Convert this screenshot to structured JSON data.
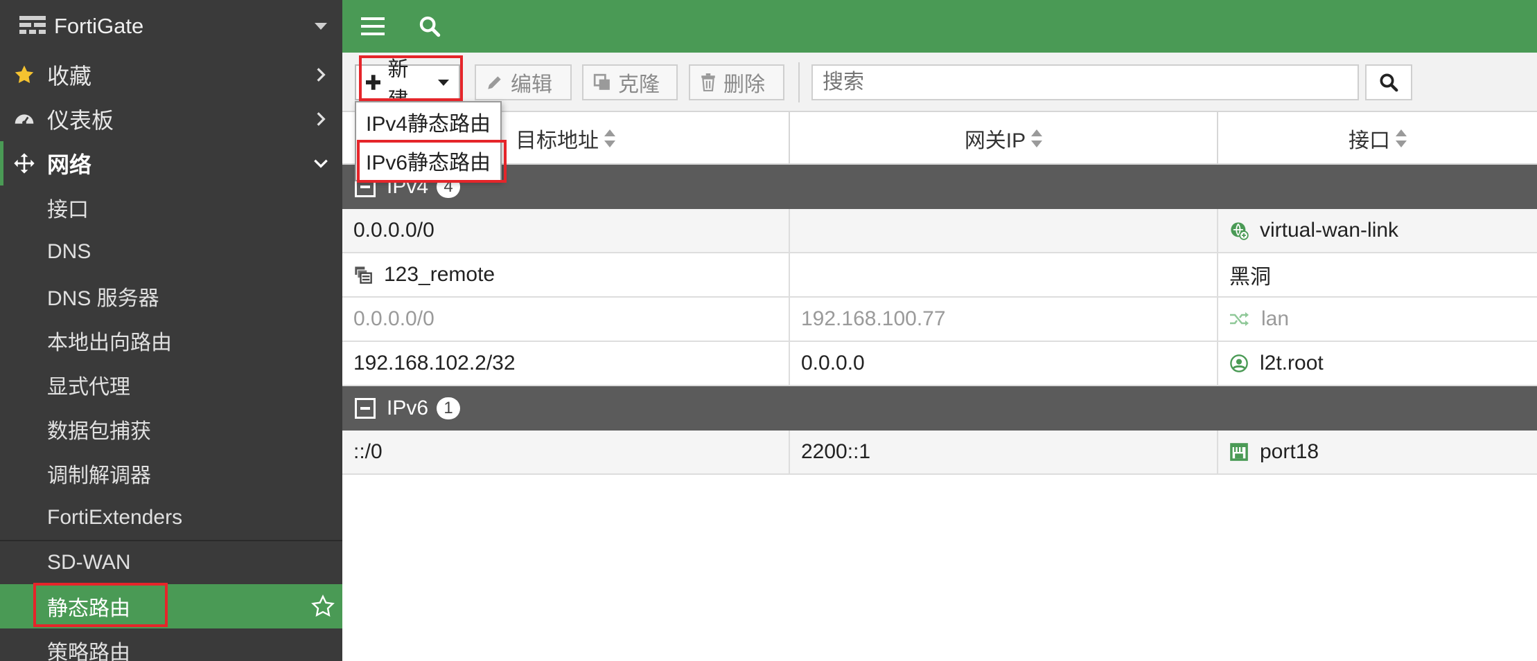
{
  "app": {
    "title": "FortiGate"
  },
  "sidebar": {
    "top_items": [
      {
        "label": "收藏",
        "icon": "star-icon"
      },
      {
        "label": "仪表板",
        "icon": "dashboard-icon"
      },
      {
        "label": "网络",
        "icon": "move-icon"
      }
    ],
    "sub_items": [
      {
        "label": "接口"
      },
      {
        "label": "DNS"
      },
      {
        "label": "DNS 服务器"
      },
      {
        "label": "本地出向路由"
      },
      {
        "label": "显式代理"
      },
      {
        "label": "数据包捕获"
      },
      {
        "label": "调制解调器"
      },
      {
        "label": "FortiExtenders"
      },
      {
        "label": "SD-WAN"
      },
      {
        "label": "静态路由",
        "selected": true
      },
      {
        "label": "策略路由"
      }
    ]
  },
  "toolbar": {
    "new_label": "新建",
    "edit_label": "编辑",
    "clone_label": "克隆",
    "delete_label": "删除",
    "search_placeholder": "搜索"
  },
  "dropdown": {
    "items": [
      {
        "label": "IPv4静态路由"
      },
      {
        "label": "IPv6静态路由"
      }
    ]
  },
  "table": {
    "columns": [
      {
        "label": "目标地址"
      },
      {
        "label": "网关IP"
      },
      {
        "label": "接口"
      }
    ],
    "groups": [
      {
        "name": "IPv4",
        "count": "4",
        "rows": [
          {
            "dest": "0.0.0.0/0",
            "gateway": "",
            "iface": "virtual-wan-link",
            "iface_icon": "sd-wan-icon"
          },
          {
            "dest": "123_remote",
            "dest_icon": "address-group-icon",
            "gateway": "",
            "iface": "黑洞"
          },
          {
            "dest": "0.0.0.0/0",
            "gateway": "192.168.100.77",
            "iface": "lan",
            "iface_icon": "shuffle-icon",
            "disabled": true
          },
          {
            "dest": "192.168.102.2/32",
            "gateway": "0.0.0.0",
            "iface": "l2t.root",
            "iface_icon": "tunnel-icon"
          }
        ]
      },
      {
        "name": "IPv6",
        "count": "1",
        "rows": [
          {
            "dest": "::/0",
            "gateway": "2200::1",
            "iface": "port18",
            "iface_icon": "port-icon"
          }
        ]
      }
    ]
  },
  "colors": {
    "brand_green": "#4a9a55",
    "sidebar_bg": "#3a3a3a",
    "highlight_red": "#e5252a",
    "group_bg": "#5b5b5b"
  }
}
